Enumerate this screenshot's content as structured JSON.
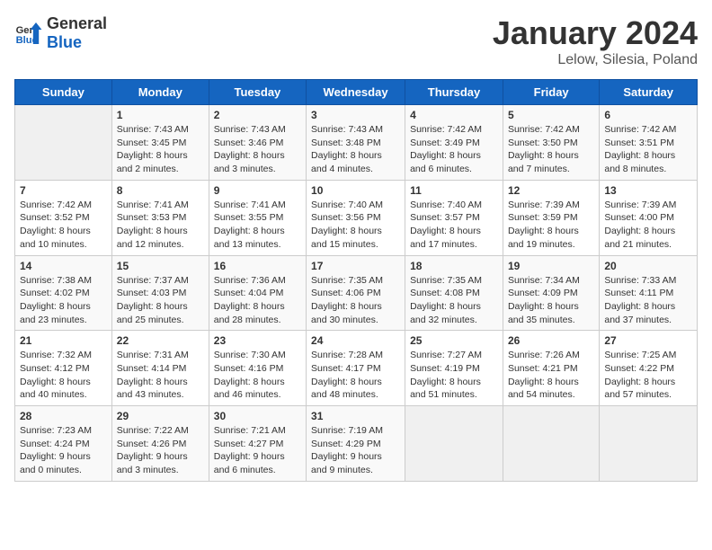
{
  "header": {
    "logo_general": "General",
    "logo_blue": "Blue",
    "title": "January 2024",
    "subtitle": "Lelow, Silesia, Poland"
  },
  "days_of_week": [
    "Sunday",
    "Monday",
    "Tuesday",
    "Wednesday",
    "Thursday",
    "Friday",
    "Saturday"
  ],
  "weeks": [
    [
      {
        "day": "",
        "info": ""
      },
      {
        "day": "1",
        "info": "Sunrise: 7:43 AM\nSunset: 3:45 PM\nDaylight: 8 hours\nand 2 minutes."
      },
      {
        "day": "2",
        "info": "Sunrise: 7:43 AM\nSunset: 3:46 PM\nDaylight: 8 hours\nand 3 minutes."
      },
      {
        "day": "3",
        "info": "Sunrise: 7:43 AM\nSunset: 3:48 PM\nDaylight: 8 hours\nand 4 minutes."
      },
      {
        "day": "4",
        "info": "Sunrise: 7:42 AM\nSunset: 3:49 PM\nDaylight: 8 hours\nand 6 minutes."
      },
      {
        "day": "5",
        "info": "Sunrise: 7:42 AM\nSunset: 3:50 PM\nDaylight: 8 hours\nand 7 minutes."
      },
      {
        "day": "6",
        "info": "Sunrise: 7:42 AM\nSunset: 3:51 PM\nDaylight: 8 hours\nand 8 minutes."
      }
    ],
    [
      {
        "day": "7",
        "info": "Sunrise: 7:42 AM\nSunset: 3:52 PM\nDaylight: 8 hours\nand 10 minutes."
      },
      {
        "day": "8",
        "info": "Sunrise: 7:41 AM\nSunset: 3:53 PM\nDaylight: 8 hours\nand 12 minutes."
      },
      {
        "day": "9",
        "info": "Sunrise: 7:41 AM\nSunset: 3:55 PM\nDaylight: 8 hours\nand 13 minutes."
      },
      {
        "day": "10",
        "info": "Sunrise: 7:40 AM\nSunset: 3:56 PM\nDaylight: 8 hours\nand 15 minutes."
      },
      {
        "day": "11",
        "info": "Sunrise: 7:40 AM\nSunset: 3:57 PM\nDaylight: 8 hours\nand 17 minutes."
      },
      {
        "day": "12",
        "info": "Sunrise: 7:39 AM\nSunset: 3:59 PM\nDaylight: 8 hours\nand 19 minutes."
      },
      {
        "day": "13",
        "info": "Sunrise: 7:39 AM\nSunset: 4:00 PM\nDaylight: 8 hours\nand 21 minutes."
      }
    ],
    [
      {
        "day": "14",
        "info": "Sunrise: 7:38 AM\nSunset: 4:02 PM\nDaylight: 8 hours\nand 23 minutes."
      },
      {
        "day": "15",
        "info": "Sunrise: 7:37 AM\nSunset: 4:03 PM\nDaylight: 8 hours\nand 25 minutes."
      },
      {
        "day": "16",
        "info": "Sunrise: 7:36 AM\nSunset: 4:04 PM\nDaylight: 8 hours\nand 28 minutes."
      },
      {
        "day": "17",
        "info": "Sunrise: 7:35 AM\nSunset: 4:06 PM\nDaylight: 8 hours\nand 30 minutes."
      },
      {
        "day": "18",
        "info": "Sunrise: 7:35 AM\nSunset: 4:08 PM\nDaylight: 8 hours\nand 32 minutes."
      },
      {
        "day": "19",
        "info": "Sunrise: 7:34 AM\nSunset: 4:09 PM\nDaylight: 8 hours\nand 35 minutes."
      },
      {
        "day": "20",
        "info": "Sunrise: 7:33 AM\nSunset: 4:11 PM\nDaylight: 8 hours\nand 37 minutes."
      }
    ],
    [
      {
        "day": "21",
        "info": "Sunrise: 7:32 AM\nSunset: 4:12 PM\nDaylight: 8 hours\nand 40 minutes."
      },
      {
        "day": "22",
        "info": "Sunrise: 7:31 AM\nSunset: 4:14 PM\nDaylight: 8 hours\nand 43 minutes."
      },
      {
        "day": "23",
        "info": "Sunrise: 7:30 AM\nSunset: 4:16 PM\nDaylight: 8 hours\nand 46 minutes."
      },
      {
        "day": "24",
        "info": "Sunrise: 7:28 AM\nSunset: 4:17 PM\nDaylight: 8 hours\nand 48 minutes."
      },
      {
        "day": "25",
        "info": "Sunrise: 7:27 AM\nSunset: 4:19 PM\nDaylight: 8 hours\nand 51 minutes."
      },
      {
        "day": "26",
        "info": "Sunrise: 7:26 AM\nSunset: 4:21 PM\nDaylight: 8 hours\nand 54 minutes."
      },
      {
        "day": "27",
        "info": "Sunrise: 7:25 AM\nSunset: 4:22 PM\nDaylight: 8 hours\nand 57 minutes."
      }
    ],
    [
      {
        "day": "28",
        "info": "Sunrise: 7:23 AM\nSunset: 4:24 PM\nDaylight: 9 hours\nand 0 minutes."
      },
      {
        "day": "29",
        "info": "Sunrise: 7:22 AM\nSunset: 4:26 PM\nDaylight: 9 hours\nand 3 minutes."
      },
      {
        "day": "30",
        "info": "Sunrise: 7:21 AM\nSunset: 4:27 PM\nDaylight: 9 hours\nand 6 minutes."
      },
      {
        "day": "31",
        "info": "Sunrise: 7:19 AM\nSunset: 4:29 PM\nDaylight: 9 hours\nand 9 minutes."
      },
      {
        "day": "",
        "info": ""
      },
      {
        "day": "",
        "info": ""
      },
      {
        "day": "",
        "info": ""
      }
    ]
  ]
}
